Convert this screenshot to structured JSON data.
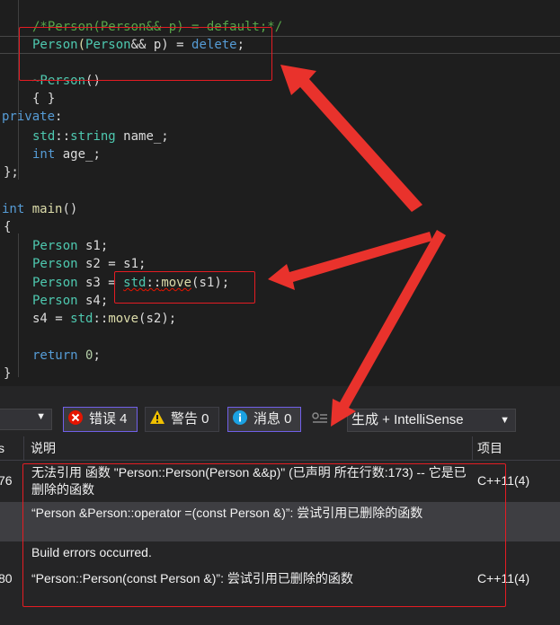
{
  "editor": {
    "lines": [
      "/*Person(Person&& p) = default;*/",
      "Person(Person&& p) = delete;",
      "",
      "~Person()",
      "{ }",
      "private:",
      "std::string name_;",
      "int age_;",
      "};",
      "",
      "int main()",
      "{",
      "",
      "Person s1;",
      "Person s2 = s1;",
      "Person s3 = std::move(s1);",
      "Person s4;",
      "s4 = std::move(s2);",
      "",
      "return 0;",
      "}"
    ]
  },
  "error_list": {
    "scope_dropdown": "",
    "errors_filter": "错误 4",
    "warnings_filter": "警告 0",
    "messages_filter": "消息 0",
    "build_source": "生成 + IntelliSense",
    "columns": {
      "code": "s",
      "description": "说明",
      "project": "项目"
    },
    "rows": [
      {
        "code": "76",
        "description": "无法引用 函数 \"Person::Person(Person &&p)\" (已声明 所在行数:173) -- 它是已删除的函数",
        "project": "C++11(4)"
      },
      {
        "code": "",
        "description": "“Person &Person::operator =(const Person &)”: 尝试引用已删除的函数",
        "project": ""
      },
      {
        "code": "",
        "description": "Build errors occurred.",
        "project": ""
      },
      {
        "code": "80",
        "description": "“Person::Person(const Person &)”: 尝试引用已删除的函数",
        "project": "C++11(4)"
      }
    ]
  },
  "colors": {
    "editor_bg": "#1e1e1e",
    "keyword": "#569cd6",
    "type": "#4ec9b0",
    "comment": "#57a64a",
    "annotation_red": "#e51c23",
    "error_red": "#e51400"
  }
}
